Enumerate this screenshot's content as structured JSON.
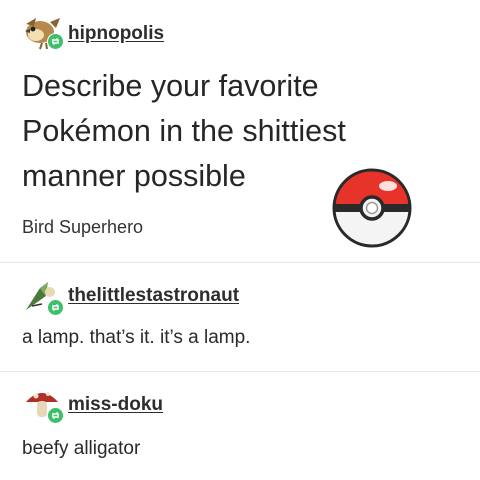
{
  "posts": [
    {
      "username": "hipnopolis",
      "title": "Describe your favorite Pokémon in the shittiest manner possible",
      "body": "Bird Superhero",
      "avatar_icon": "pidgey-avatar-icon"
    },
    {
      "username": "thelittlestastronaut",
      "body": "a lamp. that’s it. it’s a lamp.",
      "avatar_icon": "astronaut-avatar-icon"
    },
    {
      "username": "miss-doku",
      "body": "beefy alligator",
      "avatar_icon": "mushroom-avatar-icon"
    }
  ],
  "icons": {
    "reblog_badge": "reblog-icon",
    "pokeball": "pokeball-icon"
  },
  "colors": {
    "reblog_green": "#3fbf6a",
    "pokeball_red": "#e8332a",
    "text": "#2b2b2b",
    "divider": "#e6e6e6"
  }
}
